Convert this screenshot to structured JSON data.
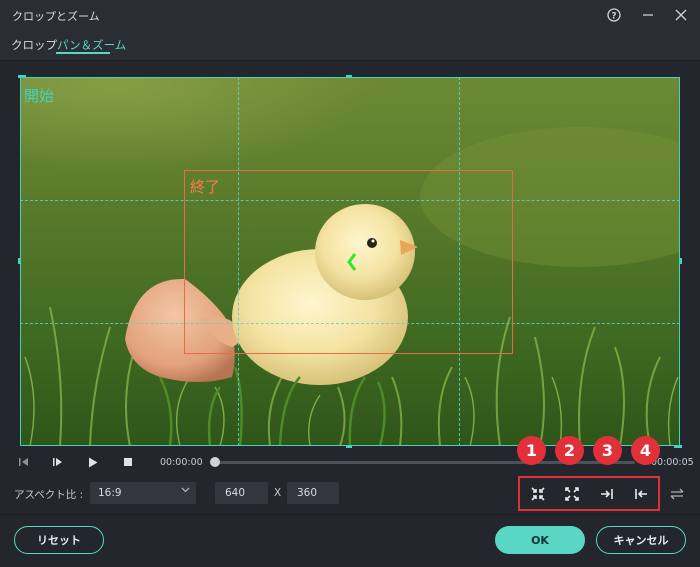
{
  "window": {
    "title": "クロップとズーム",
    "help_icon": "help-icon",
    "minimize_icon": "minimize-icon",
    "close_icon": "close-icon"
  },
  "tabs": [
    {
      "label": "クロップ",
      "active": false
    },
    {
      "label": "パン＆ズーム",
      "active": true
    }
  ],
  "preview": {
    "start_label": "開始",
    "end_label": "終了",
    "start_color": "#3fd5c2",
    "end_color": "#e86b48"
  },
  "player": {
    "current_time": "00:00:00",
    "end_time": "00:00:05",
    "progress": 0,
    "controls": [
      "step-back-icon",
      "play-frame-icon",
      "play-icon",
      "stop-icon"
    ]
  },
  "aspect": {
    "label": "アスペクト比 :",
    "selected": "16:9",
    "width": "640",
    "separator": "X",
    "height": "360"
  },
  "tools": {
    "badges": [
      "1",
      "2",
      "3",
      "4"
    ],
    "icons": [
      "fit-icon",
      "fill-icon",
      "end-to-start-icon",
      "start-to-end-icon",
      "swap-icon"
    ],
    "highlight_color": "#e1303a"
  },
  "footer": {
    "reset_label": "リセット",
    "ok_label": "OK",
    "cancel_label": "キャンセル",
    "accent": "#5ad6c4"
  }
}
